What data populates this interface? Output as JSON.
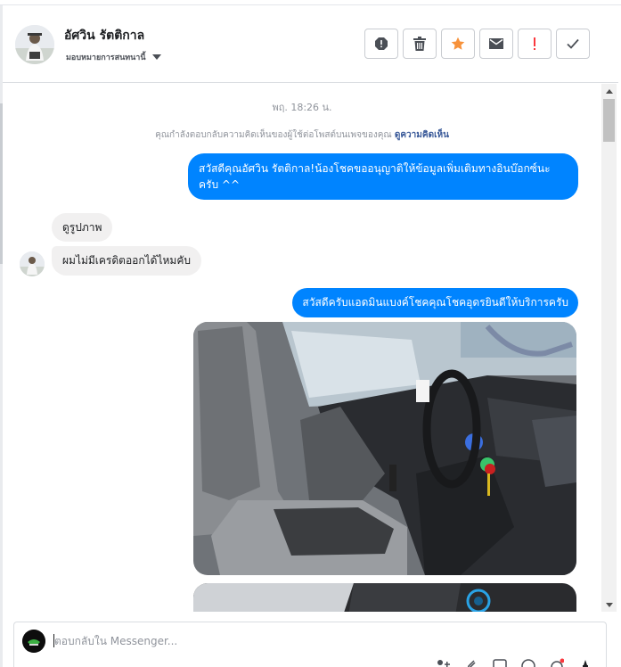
{
  "header": {
    "contact_name": "อัศวิน รัตติกาล",
    "assign_label": "มอบหมายการสนทนานี้"
  },
  "actions": [
    {
      "name": "report-icon",
      "color": "#4b4f56"
    },
    {
      "name": "trash-icon",
      "color": "#4b4f56"
    },
    {
      "name": "star-icon",
      "color": "#f7923b"
    },
    {
      "name": "mail-icon",
      "color": "#4b4f56"
    },
    {
      "name": "spam-icon",
      "color": "#fa383e"
    },
    {
      "name": "checkmark-icon",
      "color": "#4b4f56"
    }
  ],
  "conversation": {
    "timestamp": "พฤ. 18:26 น.",
    "notice_text": "คุณกำลังตอบกลับความคิดเห็นของผู้ใช้ต่อโพสต์บนเพจของคุณ",
    "notice_link": "ดูความคิดเห็น",
    "messages": [
      {
        "direction": "out",
        "text": "สวัสดีคุณอัศวิน รัตติกาล!น้องโชคขออนุญาติให้ข้อมูลเพิ่มเติมทางอินบ๊อกซ์นะครับ ^^"
      },
      {
        "direction": "in",
        "text": "ดูรูปภาพ"
      },
      {
        "direction": "in",
        "text": "ผมไม่มีเครดิตออกได้ไหมคับ"
      },
      {
        "direction": "out",
        "text": "สวัสดีครับแอดมินแบงค์โชคคุณโชคอุดรยินดีให้บริการครับ"
      }
    ]
  },
  "composer": {
    "placeholder": "ตอบกลับใน Messenger..."
  },
  "colors": {
    "outgoing_bubble": "#0084ff",
    "incoming_bubble": "#f1f0f0",
    "link": "#385898"
  }
}
